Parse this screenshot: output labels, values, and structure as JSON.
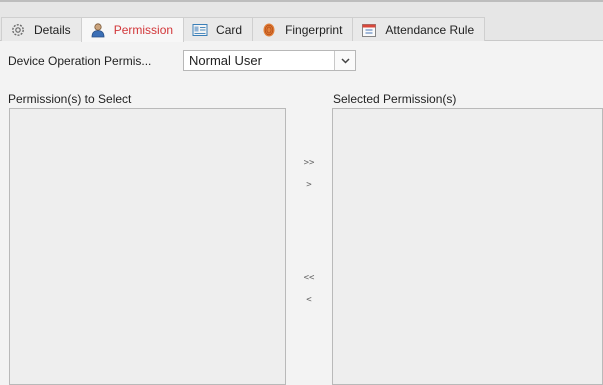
{
  "tabs": [
    {
      "label": "Details",
      "icon": "gear-icon",
      "active": false
    },
    {
      "label": "Permission",
      "icon": "user-icon",
      "active": true
    },
    {
      "label": "Card",
      "icon": "card-icon",
      "active": false
    },
    {
      "label": "Fingerprint",
      "icon": "fingerprint-icon",
      "active": false
    },
    {
      "label": "Attendance Rule",
      "icon": "calendar-icon",
      "active": false
    }
  ],
  "device_operation": {
    "label": "Device Operation Permis...",
    "value": "Normal User"
  },
  "left_panel": {
    "label": "Permission(s) to Select"
  },
  "right_panel": {
    "label": "Selected Permission(s)"
  },
  "transfer": {
    "add_all": ">>",
    "add_one": ">",
    "remove_all": "<<",
    "remove_one": "<"
  },
  "colors": {
    "active_tab_text": "#d2373a"
  }
}
